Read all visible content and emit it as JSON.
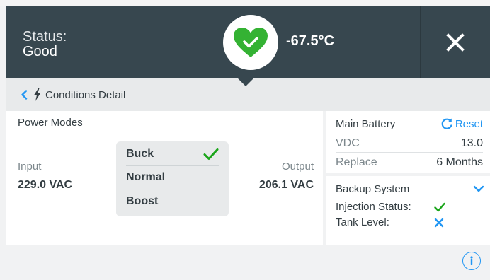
{
  "header": {
    "status_label": "Status:",
    "status_value": "Good",
    "temperature": "-67.5°C",
    "status_icon": "heart-check-icon",
    "close_icon": "close-icon",
    "colors": {
      "background": "#37474f",
      "status_good": "#34b233"
    }
  },
  "breadcrumb": {
    "back_icon": "chevron-left-icon",
    "section_icon": "lightning-bolt-icon",
    "label": "Conditions Detail"
  },
  "power_modes": {
    "title": "Power Modes",
    "input": {
      "label": "Input",
      "value": "229.0 VAC"
    },
    "output": {
      "label": "Output",
      "value": "206.1 VAC"
    },
    "modes": [
      {
        "label": "Buck",
        "selected": true
      },
      {
        "label": "Normal",
        "selected": false
      },
      {
        "label": "Boost",
        "selected": false
      }
    ]
  },
  "main_battery": {
    "title": "Main Battery",
    "reset_label": "Reset",
    "rows": [
      {
        "label": "VDC",
        "value": "13.0"
      },
      {
        "label": "Replace",
        "value": "6 Months"
      }
    ]
  },
  "backup_system": {
    "title": "Backup System",
    "rows": [
      {
        "label": "Injection Status:",
        "status": "ok"
      },
      {
        "label": "Tank Level:",
        "status": "fail"
      }
    ]
  },
  "footer": {
    "info_icon": "info-icon"
  },
  "colors": {
    "accent": "#2196f3",
    "ok": "#1aa51a"
  }
}
